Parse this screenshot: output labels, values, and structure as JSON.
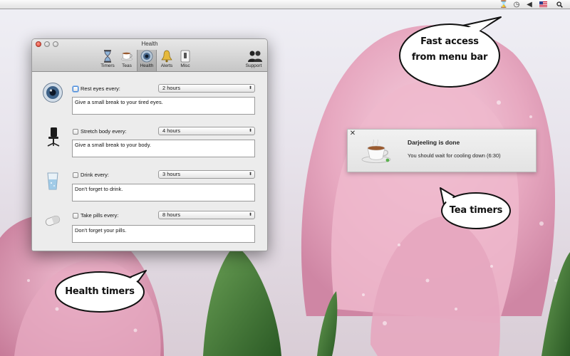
{
  "menubar": {
    "icons": [
      "hourglass-icon",
      "time-machine-icon",
      "volume-icon",
      "us-flag-icon",
      "spotlight-icon"
    ]
  },
  "window": {
    "title": "Health",
    "toolbar": [
      {
        "label": "Timers",
        "icon": "hourglass-icon"
      },
      {
        "label": "Teas",
        "icon": "teacup-icon"
      },
      {
        "label": "Health",
        "icon": "eye-icon",
        "selected": true
      },
      {
        "label": "Alerts",
        "icon": "bell-icon"
      },
      {
        "label": "Misc",
        "icon": "switch-icon"
      },
      {
        "label": "Support",
        "icon": "people-icon"
      }
    ],
    "rows": [
      {
        "label": "Rest eyes every:",
        "interval": "2 hours",
        "message": "Give a small break to your tired eyes.",
        "icon": "eye-icon",
        "checked": false
      },
      {
        "label": "Stretch body every:",
        "interval": "4 hours",
        "message": "Give a small break to your body.",
        "icon": "office-chair-icon",
        "checked": false
      },
      {
        "label": "Drink every:",
        "interval": "3 hours",
        "message": "Don't forget to drink.",
        "icon": "water-glass-icon",
        "checked": false
      },
      {
        "label": "Take pills every:",
        "interval": "8 hours",
        "message": "Don't forget your pills.",
        "icon": "pill-icon",
        "checked": false
      }
    ]
  },
  "notification": {
    "title": "Darjeeling is done",
    "message": "You should wait for cooling down (6:30)",
    "icon": "teacup-icon"
  },
  "callouts": {
    "menu": "Fast access from menu bar",
    "tea": "Tea timers",
    "health": "Health timers"
  },
  "colors": {
    "tulip_pink": "#e9b2c7",
    "leaf_green": "#3f7a35",
    "selection_blue": "#4b8ad7"
  }
}
